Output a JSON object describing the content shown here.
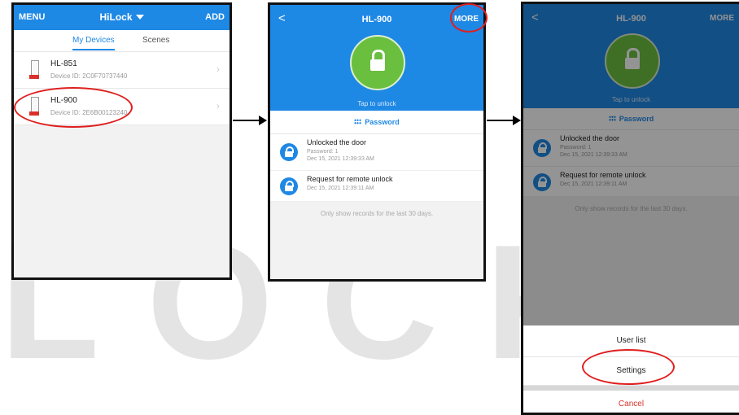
{
  "watermark": "LOCK",
  "screen1": {
    "menu": "MENU",
    "title": "HiLock",
    "add": "ADD",
    "tabs": [
      "My Devices",
      "Scenes"
    ],
    "devices": [
      {
        "name": "HL-851",
        "device_id": "Device ID: 2C0F70737440"
      },
      {
        "name": "HL-900",
        "device_id": "Device ID: 2E6B00123240"
      }
    ]
  },
  "screen2": {
    "back": "<",
    "title": "HL-900",
    "more": "MORE",
    "tap": "Tap to unlock",
    "mode": "Password",
    "records": [
      {
        "title": "Unlocked the door",
        "line1": "Password: 1",
        "line2": "Dec 15, 2021 12:39:33 AM"
      },
      {
        "title": "Request for remote unlock",
        "line1": "",
        "line2": "Dec 15, 2021 12:39:11 AM"
      }
    ],
    "note": "Only show records for the last 30 days."
  },
  "screen3": {
    "sheet": [
      "User list",
      "Settings",
      "Cancel"
    ]
  },
  "colors": {
    "brand_blue": "#1e88e5",
    "unlock_green": "#6bbf3f",
    "highlight_red": "#e01e1e",
    "cancel_red": "#d9302c"
  }
}
